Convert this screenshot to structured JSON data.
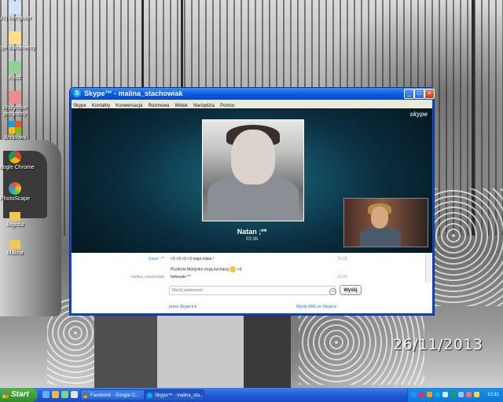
{
  "desktop": {
    "icons": [
      {
        "label": "Mój komputer",
        "icon": "computer-icon",
        "color": "#cfe3ff"
      },
      {
        "label": "Moje dokumenty",
        "icon": "documents-icon",
        "color": "#ffe08a"
      },
      {
        "label": "Kosz",
        "icon": "recycle-bin-icon",
        "color": "#8fd18f"
      },
      {
        "label": "Wszystkie programy",
        "icon": "programs-icon",
        "color": "#f28b8b"
      },
      {
        "label": "Windows",
        "icon": "windows-icon",
        "color": "#9fd4ff"
      },
      {
        "label": "Google Chrome",
        "icon": "chrome-icon",
        "color": "#f0b33a"
      },
      {
        "label": "PhotoScape",
        "icon": "photoscape-icon",
        "color": "#ffffff"
      },
      {
        "label": "Jagoda",
        "icon": "folder-icon",
        "color": "#f2c94c"
      },
      {
        "label": "Malina",
        "icon": "folder-icon",
        "color": "#f2c94c"
      }
    ],
    "date_stamp": "26/11/2013"
  },
  "skype": {
    "title": "Skype™ - malina_stachowiak",
    "menu": [
      "Skype",
      "Kontakty",
      "Konwersacja",
      "Rozmowa",
      "Widok",
      "Narzędzia",
      "Pomoc"
    ],
    "logo": "skype",
    "call": {
      "contact_name": "Natan ;**",
      "timer": "03:36"
    },
    "chat": {
      "messages": [
        {
          "sender": "Natan ;**",
          "text": "<3 <3 <3 <3 moja misia !",
          "time": "10:29",
          "self": false
        },
        {
          "sender": "",
          "text": "Pozdrów Martynke moją kochaną",
          "suffix": "<3",
          "time": "",
          "self": false
        },
        {
          "sender": "malina_stachowiak",
          "text": "heheszki ^^",
          "time": "10:29",
          "self": true
        }
      ],
      "input_placeholder": "Wyślij wiadomość",
      "send_label": "Wyślij",
      "via_prefix": "przez",
      "via_brand": "Skype'a",
      "sms_link": "Wyślij SMS ze Skype'a"
    }
  },
  "taskbar": {
    "start_label": "Start",
    "tasks": [
      {
        "label": "Facebook - Google C...",
        "icon": "chrome-icon",
        "active": false
      },
      {
        "label": "Skype™ - malina_sta...",
        "icon": "skype-icon",
        "active": true
      }
    ],
    "clock": "10:31"
  }
}
